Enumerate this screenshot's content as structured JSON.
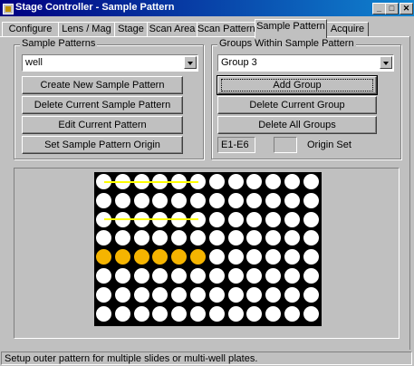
{
  "window": {
    "title": "Stage Controller - Sample Pattern",
    "controls": [
      "_",
      "□",
      "✕"
    ]
  },
  "tabs": [
    {
      "label": "Configure"
    },
    {
      "label": "Lens / Mag"
    },
    {
      "label": "Stage"
    },
    {
      "label": "Scan Area"
    },
    {
      "label": "Scan Pattern"
    },
    {
      "label": "Sample Pattern",
      "active": true
    },
    {
      "label": "Acquire"
    }
  ],
  "sample_patterns": {
    "group_label": "Sample Patterns",
    "selected": "well",
    "buttons": {
      "create": "Create New Sample Pattern",
      "delete": "Delete Current Sample Pattern",
      "edit": "Edit Current Pattern",
      "origin": "Set Sample Pattern Origin"
    }
  },
  "groups": {
    "group_label": "Groups Within Sample Pattern",
    "selected": "Group 3",
    "buttons": {
      "add": "Add Group",
      "delete_current": "Delete Current Group",
      "delete_all": "Delete All Groups"
    },
    "range_value": "E1-E6",
    "origin_value": "",
    "origin_label": "Origin Set"
  },
  "plate": {
    "rows": 8,
    "cols": 12,
    "selected_color": "#f5b400",
    "line_color": "#ffff00",
    "selected_wells": [
      [
        4,
        0
      ],
      [
        4,
        1
      ],
      [
        4,
        2
      ],
      [
        4,
        3
      ],
      [
        4,
        4
      ],
      [
        4,
        5
      ]
    ],
    "highlight_rows": [
      0,
      2
    ],
    "highlight_cols": [
      0,
      5
    ]
  },
  "status": {
    "text": "Setup outer pattern for multiple slides or multi-well plates."
  }
}
